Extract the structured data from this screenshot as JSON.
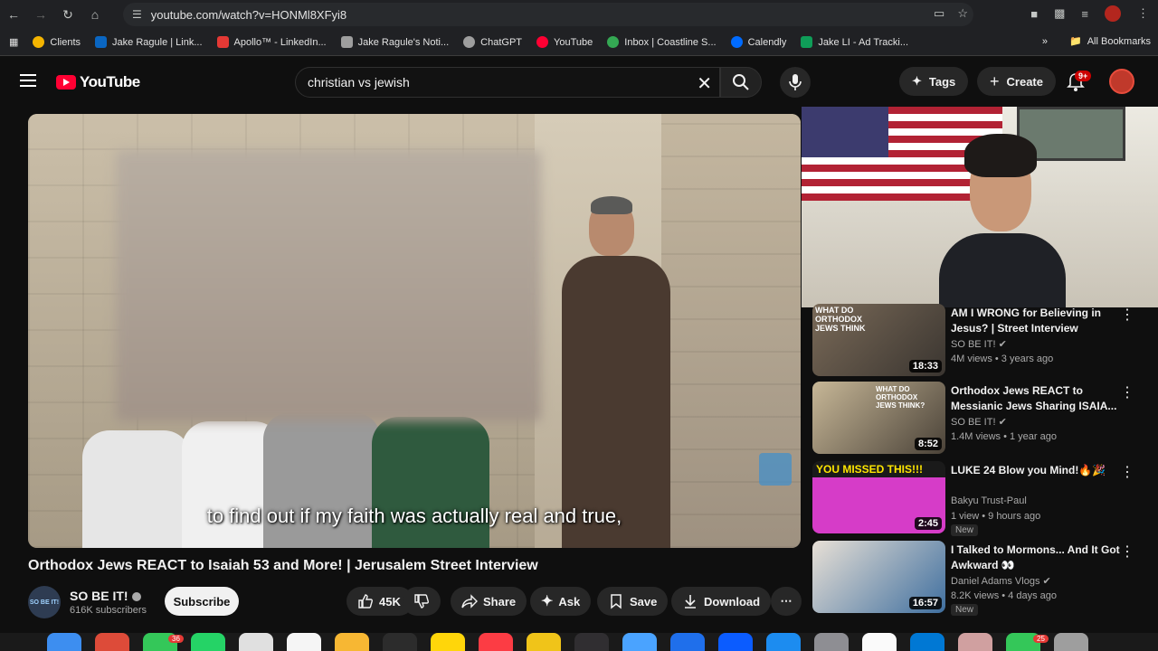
{
  "browser": {
    "url": "youtube.com/watch?v=HONMl8XFyi8",
    "bookmarks": [
      {
        "label": "Clients",
        "color": "#f4b400"
      },
      {
        "label": "Jake Ragule | Link...",
        "color": "#0a66c2"
      },
      {
        "label": "Apollo™ - LinkedIn...",
        "color": "#e53935"
      },
      {
        "label": "Jake Ragule's Noti...",
        "color": "#9e9e9e"
      },
      {
        "label": "ChatGPT",
        "color": "#9e9e9e"
      },
      {
        "label": "YouTube",
        "color": "#ff0033"
      },
      {
        "label": "Inbox | Coastline S...",
        "color": "#34a853"
      },
      {
        "label": "Calendly",
        "color": "#006bff"
      },
      {
        "label": "Jake LI - Ad Tracki...",
        "color": "#0f9d58"
      }
    ],
    "all_bookmarks": "All Bookmarks"
  },
  "youtube": {
    "logo": "YouTube",
    "search_value": "christian vs jewish",
    "tags_label": "Tags",
    "create_label": "Create",
    "notif_badge": "9+"
  },
  "video": {
    "caption": "to find out if my faith was actually real and true,",
    "title": "Orthodox Jews REACT to Isaiah 53 and More! | Jerusalem Street Interview",
    "channel": "SO BE IT!",
    "subscribers": "616K subscribers",
    "channel_avatar_text": "SO BE IT!",
    "subscribe_label": "Subscribe",
    "likes": "45K",
    "share_label": "Share",
    "ask_label": "Ask",
    "save_label": "Save",
    "download_label": "Download"
  },
  "related": [
    {
      "title": "AM I WRONG for Believing in Jesus? | Street Interview",
      "channel": "SO BE IT!",
      "meta": "4M views • 3 years ago",
      "duration": "18:33",
      "thumb_text": "WHAT DO ORTHODOX JEWS THINK",
      "new": ""
    },
    {
      "title": "Orthodox Jews REACT to Messianic Jews Sharing ISAIA...",
      "channel": "SO BE IT!",
      "meta": "1.4M views • 1 year ago",
      "duration": "8:52",
      "thumb_text": "WHAT DO ORTHODOX JEWS THINK?",
      "new": ""
    },
    {
      "title": "LUKE 24 Blow you Mind!🔥🎉",
      "channel": "Bakyu Trust-Paul",
      "meta": "1 view • 9 hours ago",
      "duration": "2:45",
      "thumb_text": "YOU MISSED THIS!!!",
      "new": "New"
    },
    {
      "title": "I Talked to Mormons... And It Got Awkward 👀",
      "channel": "Daniel Adams Vlogs",
      "meta": "8.2K views • 4 days ago",
      "duration": "16:57",
      "thumb_text": "",
      "new": "New"
    }
  ],
  "dock": {
    "badges": [
      "36",
      "25"
    ]
  }
}
